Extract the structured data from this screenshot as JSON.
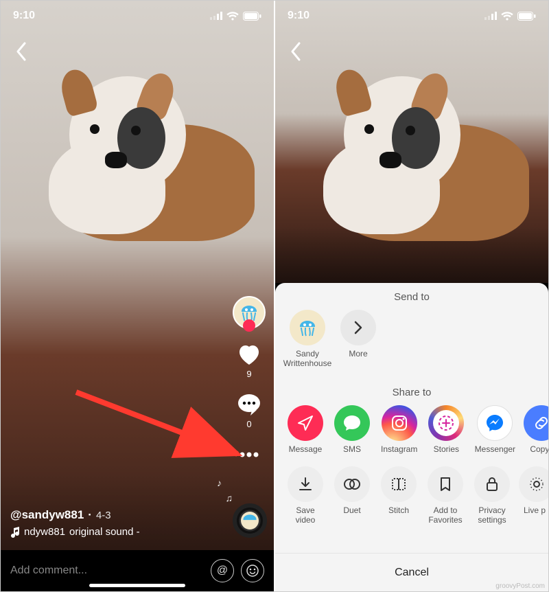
{
  "status": {
    "time": "9:10"
  },
  "video": {
    "username": "@sandyw881",
    "date": "4-3",
    "sound_prefix": "ndyw881",
    "sound_label": "original sound -",
    "likes": "9",
    "comments": "0"
  },
  "comment_input": {
    "placeholder": "Add comment..."
  },
  "sheet": {
    "send_title": "Send to",
    "share_title": "Share to",
    "contact_name": "Sandy Writtenhouse",
    "more_label": "More",
    "share_targets": {
      "message": "Message",
      "sms": "SMS",
      "instagram": "Instagram",
      "stories": "Stories",
      "messenger": "Messenger",
      "copy": "Copy"
    },
    "actions": {
      "save": "Save video",
      "duet": "Duet",
      "stitch": "Stitch",
      "favorites": "Add to Favorites",
      "privacy": "Privacy settings",
      "live": "Live p"
    },
    "cancel": "Cancel"
  },
  "watermark": "groovyPost.com"
}
